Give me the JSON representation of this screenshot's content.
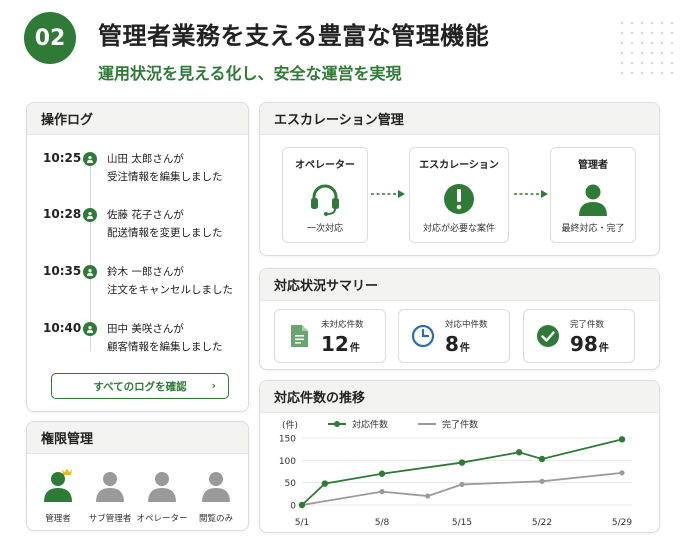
{
  "header": {
    "number": "02",
    "title": "管理者業務を支える豊富な管理機能",
    "subtitle": "運用状況を見える化し、安全な運営を実現"
  },
  "log_panel": {
    "title": "操作ログ",
    "entries": [
      {
        "time": "10:25",
        "line1": "山田 太郎さんが",
        "line2": "受注情報を編集しました"
      },
      {
        "time": "10:28",
        "line1": "佐藤 花子さんが",
        "line2": "配送情報を変更しました"
      },
      {
        "time": "10:35",
        "line1": "鈴木 一郎さんが",
        "line2": "注文をキャンセルしました"
      },
      {
        "time": "10:40",
        "line1": "田中 美咲さんが",
        "line2": "顧客情報を編集しました"
      }
    ],
    "button_label": "すべてのログを確認",
    "button_chevron": "›"
  },
  "permission_panel": {
    "title": "権限管理",
    "roles": [
      {
        "label": "管理者",
        "icon": "admin-person-crown-icon",
        "color": "#2f7a36"
      },
      {
        "label": "サブ管理者",
        "icon": "person-icon",
        "color": "#9a9a9a"
      },
      {
        "label": "オペレーター",
        "icon": "person-icon",
        "color": "#9a9a9a"
      },
      {
        "label": "閲覧のみ",
        "icon": "person-icon",
        "color": "#9a9a9a"
      }
    ]
  },
  "escalation_panel": {
    "title": "エスカレーション管理",
    "steps": [
      {
        "title": "オペレーター",
        "description": "一次対応",
        "icon": "headset-icon"
      },
      {
        "title": "エスカレーション",
        "description": "対応が必要な案件",
        "icon": "alert-circle-icon"
      },
      {
        "title": "管理者",
        "description": "最終対応・完了",
        "icon": "person-icon"
      }
    ]
  },
  "summary_panel": {
    "title": "対応状況サマリー",
    "items": [
      {
        "label": "未対応件数",
        "value": "12",
        "unit": "件",
        "icon": "document-icon"
      },
      {
        "label": "対応中件数",
        "value": "8",
        "unit": "件",
        "icon": "clock-icon"
      },
      {
        "label": "完了件数",
        "value": "98",
        "unit": "件",
        "icon": "check-circle-icon"
      }
    ]
  },
  "chart_panel": {
    "title": "対応件数の推移"
  },
  "chart_data": {
    "type": "line",
    "ylabel": "(件)",
    "ylim": [
      0,
      150
    ],
    "yticks": [
      "150",
      "100",
      "50",
      "0"
    ],
    "x_ticks": [
      "5/1",
      "5/8",
      "5/15",
      "5/22",
      "5/29"
    ],
    "series": [
      {
        "name": "対応件数",
        "color": "#2f7a36",
        "marker": "circle",
        "x": [
          1,
          3,
          8,
          15,
          20,
          22,
          29
        ],
        "values": [
          0,
          48,
          70,
          95,
          118,
          103,
          147
        ]
      },
      {
        "name": "完了件数",
        "color": "#9a9a9a",
        "marker": "circle",
        "x": [
          1,
          8,
          12,
          15,
          22,
          29
        ],
        "values": [
          0,
          30,
          20,
          46,
          53,
          72
        ]
      }
    ],
    "legend": "top-left",
    "grid": true
  },
  "colors": {
    "accent": "#2f7a36",
    "muted": "#9a9a9a",
    "gold": "#e8b923",
    "clock_blue": "#2c6fa6"
  }
}
